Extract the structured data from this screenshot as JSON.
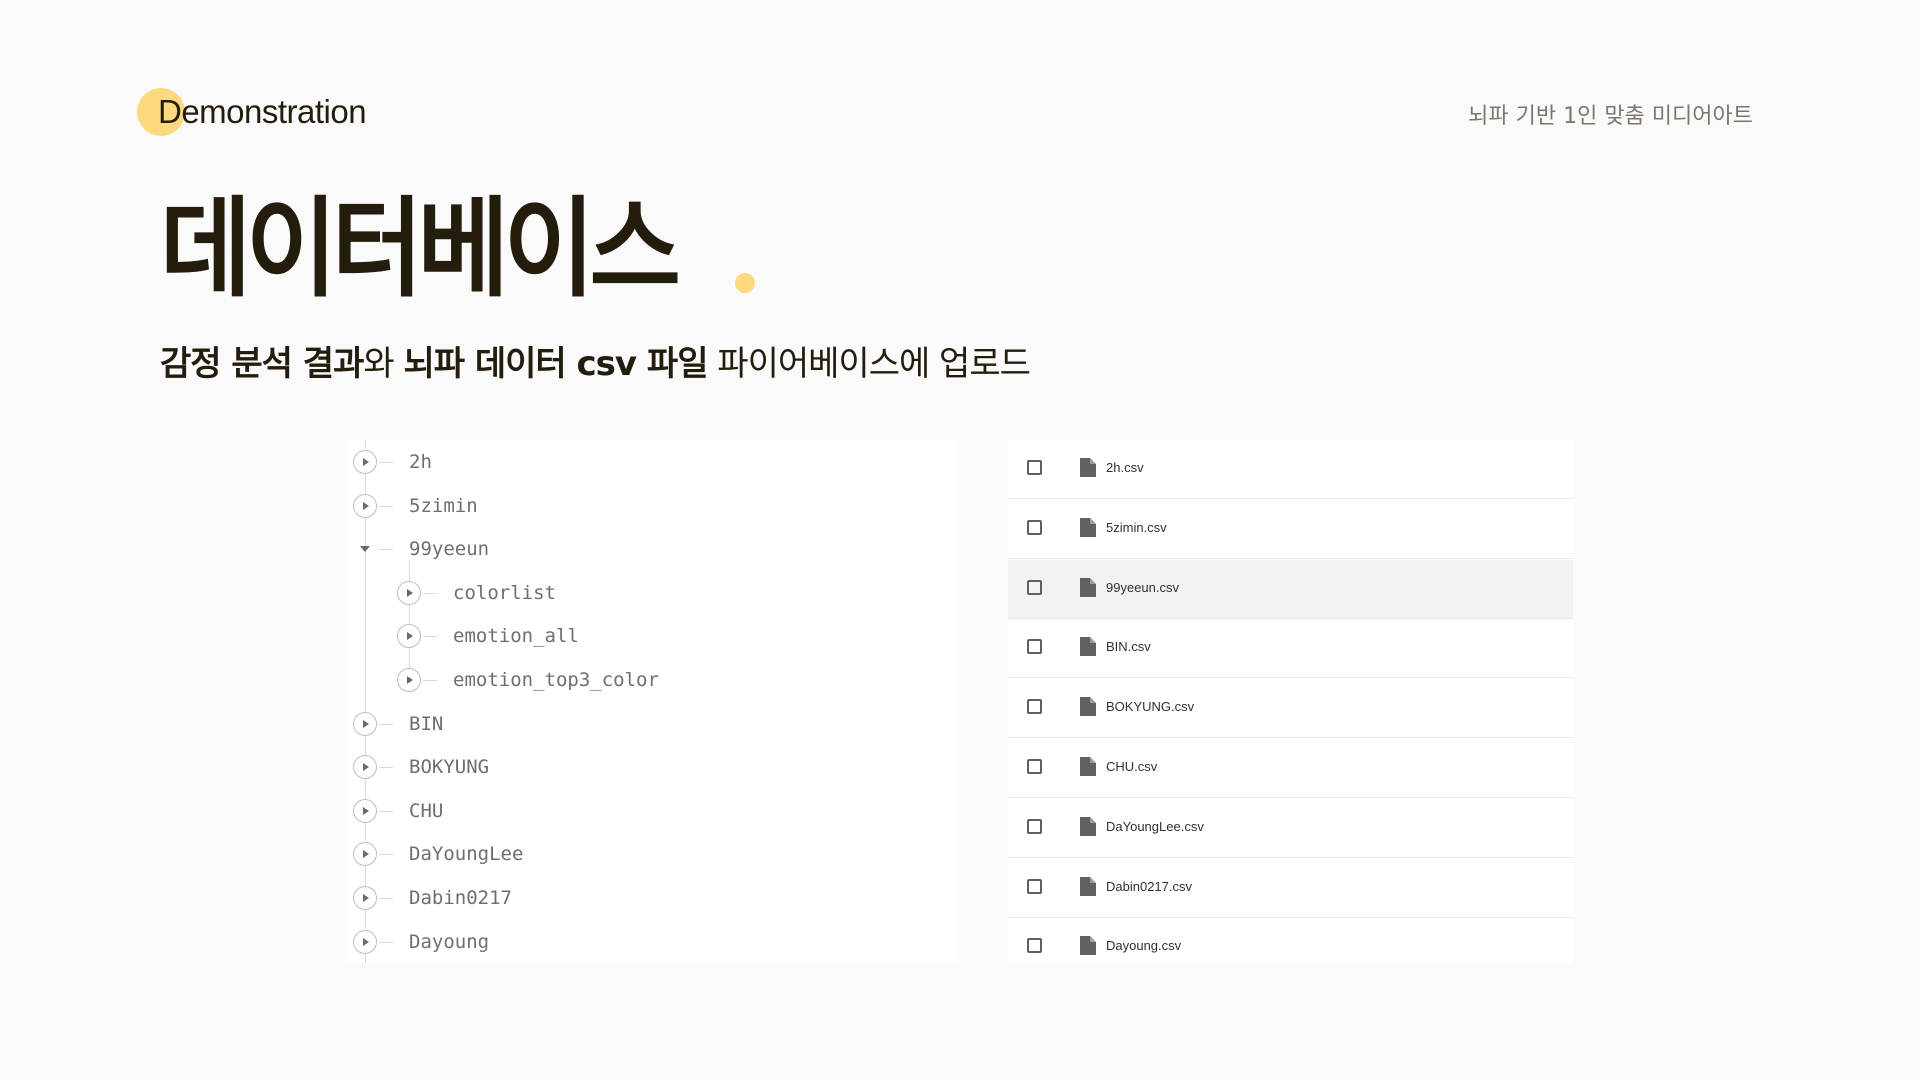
{
  "header": {
    "brand": "Demonstration",
    "subtitle": "뇌파 기반 1인 맞춤 미디어아트",
    "accent_color": "#fcd97e"
  },
  "title": "데이터베이스",
  "lead": {
    "part1": "감정 분석 결과",
    "part2": "와 ",
    "part3": "뇌파 데이터 csv 파일",
    "part4": " 파이어베이스에 업로드"
  },
  "tree": {
    "nodes": [
      {
        "label": "2h",
        "depth": 0,
        "expanded": false
      },
      {
        "label": "5zimin",
        "depth": 0,
        "expanded": false
      },
      {
        "label": "99yeeun",
        "depth": 0,
        "expanded": true
      },
      {
        "label": "colorlist",
        "depth": 1,
        "expanded": false
      },
      {
        "label": "emotion_all",
        "depth": 1,
        "expanded": false
      },
      {
        "label": "emotion_top3_color",
        "depth": 1,
        "expanded": false
      },
      {
        "label": "BIN",
        "depth": 0,
        "expanded": false
      },
      {
        "label": "BOKYUNG",
        "depth": 0,
        "expanded": false
      },
      {
        "label": "CHU",
        "depth": 0,
        "expanded": false
      },
      {
        "label": "DaYoungLee",
        "depth": 0,
        "expanded": false
      },
      {
        "label": "Dabin0217",
        "depth": 0,
        "expanded": false
      },
      {
        "label": "Dayoung",
        "depth": 0,
        "expanded": false
      }
    ]
  },
  "files": {
    "items": [
      {
        "name": "2h.csv",
        "selected": false
      },
      {
        "name": "5zimin.csv",
        "selected": false
      },
      {
        "name": "99yeeun.csv",
        "selected": true
      },
      {
        "name": "BIN.csv",
        "selected": false
      },
      {
        "name": "BOKYUNG.csv",
        "selected": false
      },
      {
        "name": "CHU.csv",
        "selected": false
      },
      {
        "name": "DaYoungLee.csv",
        "selected": false
      },
      {
        "name": "Dabin0217.csv",
        "selected": false
      },
      {
        "name": "Dayoung.csv",
        "selected": false
      }
    ],
    "file_icon": "file-icon"
  }
}
